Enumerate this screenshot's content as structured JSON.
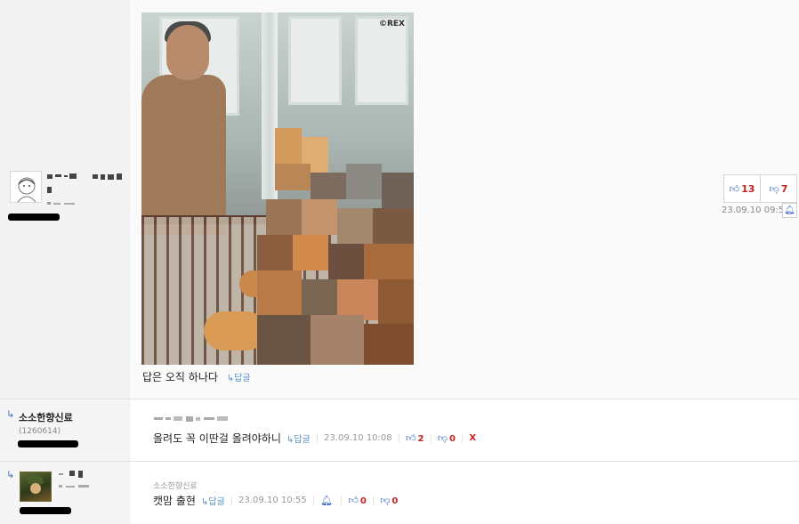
{
  "post": {
    "caption": "답은 오직 하나다",
    "reply_label": "답글",
    "photo_watermark": "©REX",
    "likes": "13",
    "dislikes": "7",
    "timestamp": "23.09.10 09:55"
  },
  "comments": [
    {
      "nickname": "소소한향신료",
      "user_id": "(1260614)",
      "text": "올려도 꼭 이딴걸 올려야하니",
      "reply_label": "답글",
      "timestamp": "23.09.10 10:08",
      "likes": "2",
      "dislikes": "0",
      "delete_label": "X"
    },
    {
      "parent_nickname": "소소한향신료",
      "text": "캣맘 출현",
      "reply_label": "답글",
      "timestamp": "23.09.10 10:55",
      "likes": "0",
      "dislikes": "0"
    }
  ],
  "icons": {
    "thumb_up": "thumbs-up-icon",
    "thumb_down": "thumbs-down-icon",
    "bell": "bell-icon",
    "reply_arrow": "reply-arrow-icon"
  },
  "colors": {
    "count_red": "#c62222",
    "link_blue": "#5b8ec7",
    "icon_blue": "#2f5fbf"
  }
}
